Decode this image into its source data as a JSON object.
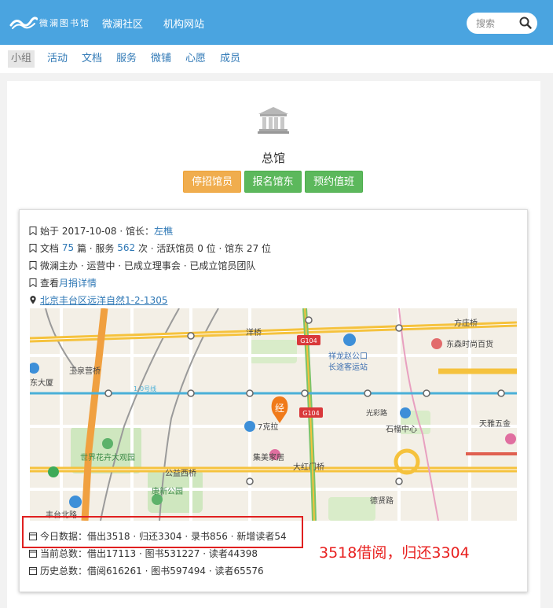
{
  "header": {
    "logo_text": "微澜图书馆",
    "nav": [
      "微澜社区",
      "机构网站"
    ],
    "search_placeholder": "搜索",
    "bg_color": "#4aa4e0"
  },
  "subnav": {
    "tabs": [
      "小组",
      "活动",
      "文档",
      "服务",
      "微铺",
      "心愿",
      "成员"
    ],
    "active_tab": "小组"
  },
  "hall": {
    "title": "总馆",
    "buttons": [
      "停招馆员",
      "报名馆东",
      "预约值班"
    ]
  },
  "info": {
    "founded_prefix": "始于 2017-10-08 · 馆长：",
    "curator": "左樵",
    "docs_prefix": "文档",
    "docs_count": "75",
    "docs_mid": "篇 · 服务",
    "service_count": "562",
    "docs_suffix": "次 · 活跃馆员 0 位 · 馆东 27 位",
    "status": "微澜主办 · 运营中 · 已成立理事会 · 已成立馆员团队",
    "report_prefix": "查看",
    "report_link": "月捐详情",
    "address": "北京丰台区远洋自然1-2-1305"
  },
  "map_labels": {
    "roads": [
      "洋桥",
      "方庄桥",
      "G104",
      "G104",
      "大红门桥",
      "公益西桥",
      "玉泉营桥",
      "1-0号线"
    ],
    "places": [
      "祥龙赵公口",
      "长途客运站",
      "东森时尚百货",
      "7克拉",
      "集美家居",
      "石榴中心",
      "天雅五金",
      "世界花卉大观园",
      "德贤路",
      "光彩路",
      "康新公园",
      "东大厦",
      "丰台北路"
    ],
    "marker": "经"
  },
  "stats": {
    "today": "今日数据：借出3518 · 归还3304 · 录书856 · 新增读者54",
    "current": "当前总数：借出17113 · 图书531227 · 读者44398",
    "history": "历史总数：借阅616261 · 图书597494 · 读者65576"
  },
  "annotation": {
    "text": "3518借阅，归还3304",
    "color": "#e8201f"
  }
}
